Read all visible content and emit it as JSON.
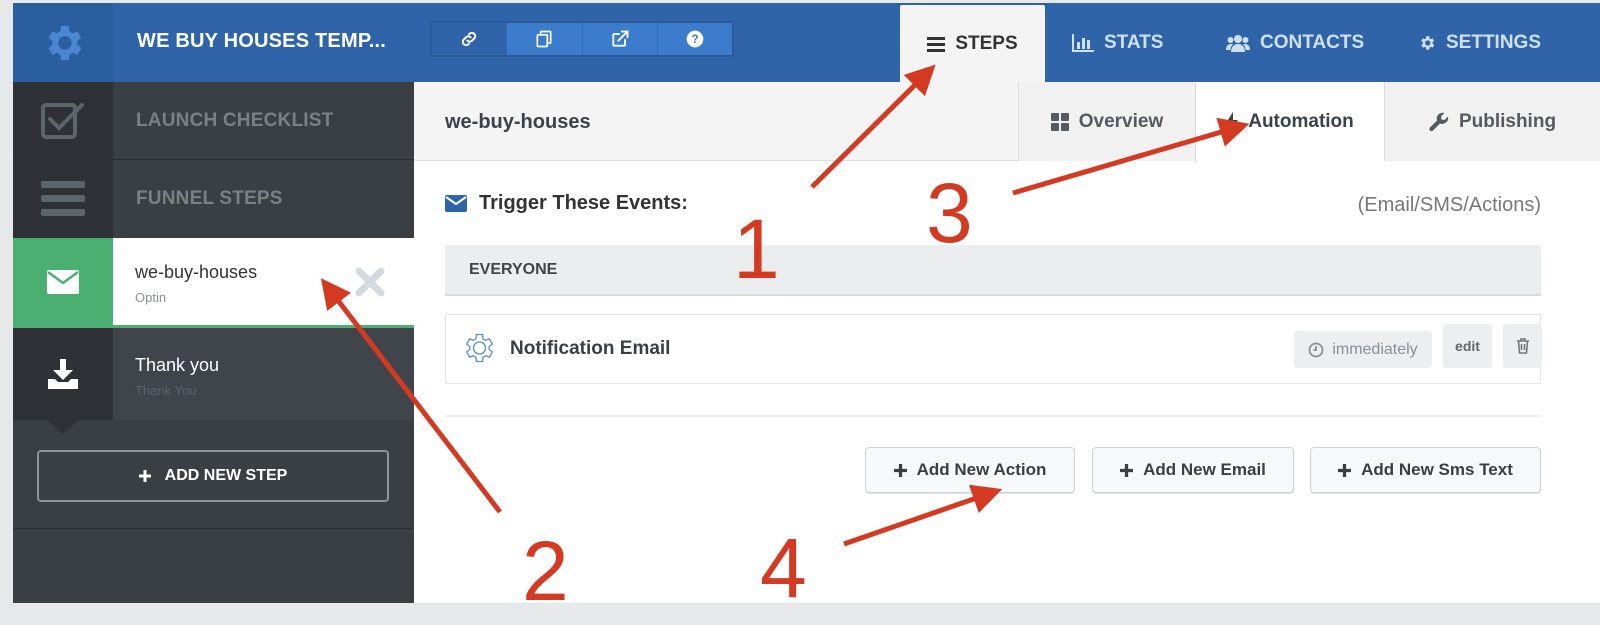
{
  "app": {
    "title": "WE BUY HOUSES TEMP...",
    "colors": {
      "brand": "#2f64a8",
      "success": "#4caf72",
      "sidebar": "#3a3f44",
      "annotation": "#d43a22"
    }
  },
  "toolbar": {
    "buttons": [
      {
        "icon": "link-icon"
      },
      {
        "icon": "copy-icon"
      },
      {
        "icon": "external-link-icon"
      },
      {
        "icon": "help-icon"
      }
    ]
  },
  "nav": {
    "tabs": [
      {
        "label": "STEPS",
        "icon": "menu-icon",
        "active": true
      },
      {
        "label": "STATS",
        "icon": "bar-chart-icon"
      },
      {
        "label": "CONTACTS",
        "icon": "users-icon"
      },
      {
        "label": "SETTINGS",
        "icon": "gear-icon"
      }
    ]
  },
  "sidebar": {
    "checklist_label": "LAUNCH CHECKLIST",
    "funnel_label": "FUNNEL STEPS",
    "steps": [
      {
        "name": "we-buy-houses",
        "type": "Optin",
        "icon": "envelope-icon",
        "active": true
      },
      {
        "name": "Thank you",
        "type": "Thank You",
        "icon": "download-icon"
      }
    ],
    "add_step_label": "ADD NEW STEP"
  },
  "main": {
    "title": "we-buy-houses",
    "subtabs": [
      {
        "label": "Overview",
        "icon": "grid-icon"
      },
      {
        "label": "Automation",
        "icon": "bolt-icon",
        "active": true
      },
      {
        "label": "Publishing",
        "icon": "wrench-icon"
      }
    ],
    "trigger_title": "Trigger These Events:",
    "trigger_meta": "(Email/SMS/Actions)",
    "group_label": "EVERYONE",
    "events": [
      {
        "name": "Notification Email",
        "timing": "immediately",
        "edit_label": "edit"
      }
    ],
    "actions": [
      {
        "label": "Add New Action"
      },
      {
        "label": "Add New Email"
      },
      {
        "label": "Add New Sms Text"
      }
    ]
  },
  "annotations": [
    "1",
    "2",
    "3",
    "4"
  ]
}
